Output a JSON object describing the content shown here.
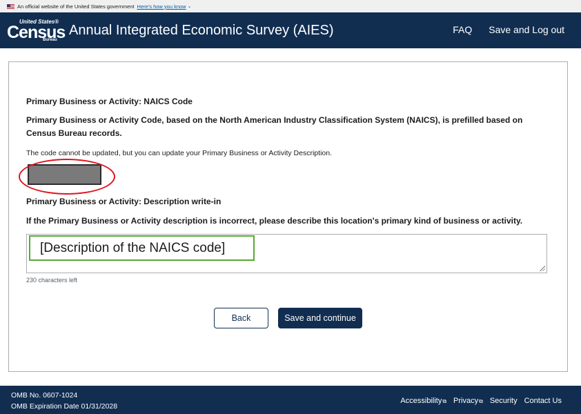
{
  "gov_banner": {
    "text": "An official website of the United States government",
    "link": "Here's how you know"
  },
  "header": {
    "logo_top": "United States®",
    "logo_main": "Census",
    "logo_bottom": "Bureau",
    "title": "Annual Integrated Economic Survey (AIES)",
    "nav": {
      "faq": "FAQ",
      "save_logout": "Save and Log out"
    }
  },
  "form": {
    "naics_heading": "Primary Business or Activity: NAICS Code",
    "naics_description": "Primary Business or Activity Code, based on the North American Industry Classification System (NAICS), is prefilled based on Census Bureau records.",
    "naics_note": "The code cannot be updated, but you can update your Primary Business or Activity Description.",
    "writein_heading": "Primary Business or Activity: Description write-in",
    "writein_prompt": "If the Primary Business or Activity description is incorrect, please describe this location's primary kind of business or activity.",
    "textarea_annotation": "[Description of the NAICS code]",
    "char_count": "230 characters left",
    "back_label": "Back",
    "continue_label": "Save and continue"
  },
  "footer": {
    "omb_number": "OMB No. 0607-1024",
    "omb_expiration": "OMB Expiration Date 01/31/2028",
    "links": {
      "accessibility": "Accessibility",
      "privacy": "Privacy",
      "security": "Security",
      "contact": "Contact Us"
    }
  },
  "colors": {
    "navy": "#112e51",
    "annotation_red": "#e0141e",
    "annotation_green": "#5aa832",
    "redacted_gray": "#7a7a7a"
  },
  "icons": {
    "flag": "us-flag-icon",
    "chevron": "chevron-down-icon",
    "external_link": "external-link-icon",
    "resize": "resize-grip-icon"
  }
}
